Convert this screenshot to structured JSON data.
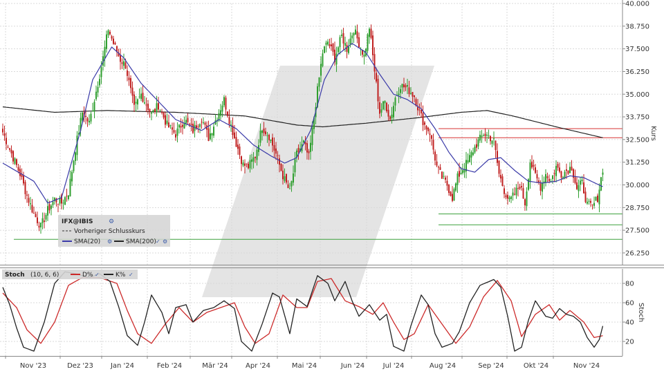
{
  "chart_data": [
    {
      "type": "candlestick",
      "instrument": "IFX@IBIS",
      "ylabel": "Kurs",
      "ylim": [
        25.6,
        40.0
      ],
      "yticks": [
        40.0,
        38.75,
        37.5,
        36.25,
        35.0,
        33.75,
        32.5,
        31.25,
        30.0,
        28.75,
        27.5,
        26.25
      ],
      "ytick_labels": [
        "40.000",
        "38.750",
        "37.500",
        "36.250",
        "35.000",
        "33.750",
        "32.500",
        "31.250",
        "30.000",
        "28.750",
        "27.500",
        "26.250"
      ],
      "x_tick_labels": [
        "Nov '23",
        "Dez '23",
        "Jan '24",
        "Feb '24",
        "Mär '24",
        "Apr '24",
        "Mai '24",
        "Jun '24",
        "Jul '24",
        "Aug '24",
        "Sep '24",
        "Okt '24",
        "Nov '24"
      ],
      "grid": true,
      "legend": {
        "title": "IFX@IBIS",
        "entries": [
          {
            "label": "Vorheriger Schlusskurs",
            "style": "dashed",
            "color": "#333333"
          },
          {
            "label": "SMA(20)",
            "color": "#3a3aa8"
          },
          {
            "label": "SMA(200)",
            "color": "#222222"
          }
        ]
      },
      "close_series_anchors": [
        [
          0,
          32.9
        ],
        [
          6,
          31.5
        ],
        [
          10,
          30.6
        ],
        [
          14,
          29.4
        ],
        [
          18,
          28.4
        ],
        [
          22,
          27.7
        ],
        [
          26,
          28.6
        ],
        [
          30,
          29.2
        ],
        [
          34,
          29.0
        ],
        [
          38,
          29.6
        ],
        [
          42,
          32.0
        ],
        [
          46,
          34.0
        ],
        [
          50,
          33.4
        ],
        [
          55,
          35.6
        ],
        [
          58,
          37.0
        ],
        [
          61,
          38.6
        ],
        [
          64,
          37.8
        ],
        [
          68,
          36.9
        ],
        [
          71,
          36.6
        ],
        [
          76,
          34.2
        ],
        [
          80,
          35.0
        ],
        [
          86,
          33.9
        ],
        [
          90,
          34.4
        ],
        [
          95,
          33.3
        ],
        [
          100,
          32.8
        ],
        [
          105,
          33.6
        ],
        [
          110,
          33.0
        ],
        [
          115,
          33.7
        ],
        [
          119,
          32.6
        ],
        [
          124,
          33.8
        ],
        [
          128,
          34.7
        ],
        [
          131,
          33.6
        ],
        [
          135,
          32.3
        ],
        [
          139,
          31.1
        ],
        [
          142,
          31.0
        ],
        [
          146,
          31.6
        ],
        [
          150,
          33.2
        ],
        [
          154,
          32.7
        ],
        [
          158,
          31.7
        ],
        [
          162,
          30.5
        ],
        [
          166,
          29.6
        ],
        [
          170,
          31.7
        ],
        [
          174,
          32.3
        ],
        [
          177,
          31.5
        ],
        [
          181,
          34.5
        ],
        [
          185,
          37.3
        ],
        [
          188,
          37.9
        ],
        [
          192,
          37.0
        ],
        [
          196,
          38.2
        ],
        [
          199,
          37.5
        ],
        [
          203,
          38.6
        ],
        [
          206,
          37.8
        ],
        [
          209,
          37.1
        ],
        [
          212,
          38.7
        ],
        [
          215,
          36.3
        ],
        [
          218,
          34.0
        ],
        [
          221,
          34.6
        ],
        [
          224,
          33.6
        ],
        [
          227,
          34.8
        ],
        [
          230,
          35.5
        ],
        [
          234,
          35.3
        ],
        [
          238,
          34.9
        ],
        [
          241,
          34.0
        ],
        [
          244,
          33.3
        ],
        [
          247,
          32.9
        ],
        [
          251,
          31.0
        ],
        [
          254,
          30.4
        ],
        [
          257,
          30.0
        ],
        [
          260,
          29.3
        ],
        [
          263,
          30.4
        ],
        [
          266,
          30.9
        ],
        [
          269,
          31.3
        ],
        [
          272,
          31.9
        ],
        [
          275,
          32.4
        ],
        [
          278,
          32.8
        ],
        [
          281,
          32.7
        ],
        [
          284,
          32.4
        ],
        [
          287,
          30.6
        ],
        [
          290,
          29.7
        ],
        [
          293,
          29.1
        ],
        [
          296,
          29.5
        ],
        [
          299,
          30.0
        ],
        [
          302,
          29.0
        ],
        [
          305,
          31.3
        ],
        [
          308,
          30.5
        ],
        [
          311,
          29.9
        ],
        [
          314,
          30.6
        ],
        [
          317,
          30.2
        ],
        [
          320,
          31.0
        ],
        [
          323,
          30.6
        ],
        [
          326,
          30.8
        ],
        [
          329,
          31.0
        ],
        [
          332,
          29.8
        ],
        [
          335,
          30.1
        ],
        [
          338,
          28.9
        ],
        [
          341,
          28.8
        ],
        [
          344,
          29.3
        ],
        [
          347,
          30.9
        ]
      ],
      "sma20_anchors": [
        [
          0,
          31.2
        ],
        [
          18,
          30.2
        ],
        [
          26,
          29.0
        ],
        [
          34,
          29.3
        ],
        [
          45,
          33.0
        ],
        [
          52,
          35.8
        ],
        [
          63,
          37.6
        ],
        [
          70,
          37.0
        ],
        [
          80,
          35.6
        ],
        [
          90,
          34.6
        ],
        [
          100,
          33.6
        ],
        [
          115,
          33.0
        ],
        [
          125,
          33.6
        ],
        [
          135,
          33.1
        ],
        [
          145,
          32.2
        ],
        [
          155,
          31.6
        ],
        [
          163,
          31.2
        ],
        [
          170,
          31.5
        ],
        [
          178,
          33.0
        ],
        [
          186,
          35.8
        ],
        [
          194,
          37.2
        ],
        [
          202,
          37.8
        ],
        [
          210,
          37.3
        ],
        [
          218,
          36.1
        ],
        [
          226,
          35.0
        ],
        [
          234,
          34.7
        ],
        [
          242,
          34.2
        ],
        [
          250,
          33.1
        ],
        [
          258,
          31.8
        ],
        [
          265,
          30.9
        ],
        [
          273,
          30.7
        ],
        [
          281,
          31.4
        ],
        [
          288,
          31.5
        ],
        [
          296,
          30.8
        ],
        [
          304,
          30.2
        ],
        [
          312,
          30.1
        ],
        [
          320,
          30.2
        ],
        [
          328,
          30.5
        ],
        [
          336,
          30.4
        ],
        [
          347,
          29.9
        ]
      ],
      "sma200_anchors": [
        [
          0,
          34.3
        ],
        [
          30,
          34.0
        ],
        [
          60,
          34.1
        ],
        [
          100,
          34.0
        ],
        [
          140,
          33.8
        ],
        [
          170,
          33.3
        ],
        [
          185,
          33.2
        ],
        [
          210,
          33.4
        ],
        [
          240,
          33.7
        ],
        [
          265,
          34.0
        ],
        [
          280,
          34.1
        ],
        [
          295,
          33.8
        ],
        [
          320,
          33.2
        ],
        [
          347,
          32.6
        ]
      ],
      "horizontal_lines": [
        {
          "value": 33.1,
          "color": "#d83232"
        },
        {
          "value": 32.6,
          "color": "#d83232"
        },
        {
          "value": 28.4,
          "color": "#3ca03c"
        },
        {
          "value": 27.8,
          "color": "#3ca03c"
        },
        {
          "value": 27.0,
          "color": "#3ca03c"
        }
      ],
      "colors": {
        "up": "#2e9e2e",
        "down": "#c02020",
        "sma20": "#3a3aa8",
        "sma200": "#222222"
      }
    },
    {
      "type": "line",
      "title": "Stoch",
      "params": "(10, 6, 6)",
      "ylabel": "Stoch",
      "ylim": [
        5,
        95
      ],
      "yticks": [
        80,
        60,
        40,
        20
      ],
      "ytick_labels": [
        "80",
        "60",
        "40",
        "20"
      ],
      "grid": true,
      "series": [
        {
          "name": "D%",
          "color": "#cc2a2a",
          "anchors": [
            [
              0,
              70
            ],
            [
              8,
              55
            ],
            [
              14,
              32
            ],
            [
              22,
              18
            ],
            [
              30,
              40
            ],
            [
              38,
              78
            ],
            [
              46,
              86
            ],
            [
              56,
              86
            ],
            [
              66,
              80
            ],
            [
              72,
              52
            ],
            [
              78,
              28
            ],
            [
              86,
              18
            ],
            [
              94,
              38
            ],
            [
              102,
              55
            ],
            [
              110,
              40
            ],
            [
              118,
              50
            ],
            [
              126,
              55
            ],
            [
              134,
              60
            ],
            [
              140,
              35
            ],
            [
              146,
              18
            ],
            [
              154,
              28
            ],
            [
              162,
              68
            ],
            [
              170,
              55
            ],
            [
              176,
              55
            ],
            [
              182,
              82
            ],
            [
              190,
              85
            ],
            [
              198,
              62
            ],
            [
              206,
              56
            ],
            [
              214,
              48
            ],
            [
              220,
              60
            ],
            [
              226,
              40
            ],
            [
              232,
              22
            ],
            [
              238,
              28
            ],
            [
              246,
              58
            ],
            [
              254,
              38
            ],
            [
              262,
              18
            ],
            [
              270,
              35
            ],
            [
              278,
              66
            ],
            [
              286,
              83
            ],
            [
              294,
              62
            ],
            [
              300,
              25
            ],
            [
              308,
              48
            ],
            [
              316,
              58
            ],
            [
              322,
              42
            ],
            [
              328,
              52
            ],
            [
              336,
              40
            ],
            [
              342,
              24
            ],
            [
              347,
              26
            ]
          ]
        },
        {
          "name": "K%",
          "color": "#222222",
          "anchors": [
            [
              0,
              76
            ],
            [
              4,
              58
            ],
            [
              8,
              34
            ],
            [
              12,
              14
            ],
            [
              18,
              10
            ],
            [
              24,
              40
            ],
            [
              30,
              80
            ],
            [
              36,
              92
            ],
            [
              42,
              90
            ],
            [
              50,
              86
            ],
            [
              56,
              90
            ],
            [
              62,
              82
            ],
            [
              67,
              56
            ],
            [
              72,
              26
            ],
            [
              78,
              16
            ],
            [
              82,
              40
            ],
            [
              86,
              68
            ],
            [
              92,
              50
            ],
            [
              96,
              28
            ],
            [
              100,
              55
            ],
            [
              106,
              58
            ],
            [
              110,
              40
            ],
            [
              116,
              52
            ],
            [
              122,
              55
            ],
            [
              128,
              62
            ],
            [
              134,
              54
            ],
            [
              138,
              20
            ],
            [
              144,
              10
            ],
            [
              150,
              38
            ],
            [
              156,
              70
            ],
            [
              160,
              66
            ],
            [
              166,
              28
            ],
            [
              170,
              64
            ],
            [
              176,
              56
            ],
            [
              182,
              88
            ],
            [
              188,
              80
            ],
            [
              192,
              62
            ],
            [
              198,
              82
            ],
            [
              202,
              62
            ],
            [
              206,
              46
            ],
            [
              212,
              58
            ],
            [
              218,
              42
            ],
            [
              222,
              48
            ],
            [
              226,
              15
            ],
            [
              232,
              10
            ],
            [
              236,
              36
            ],
            [
              242,
              68
            ],
            [
              246,
              58
            ],
            [
              250,
              28
            ],
            [
              254,
              14
            ],
            [
              260,
              18
            ],
            [
              264,
              30
            ],
            [
              270,
              60
            ],
            [
              276,
              78
            ],
            [
              284,
              84
            ],
            [
              288,
              76
            ],
            [
              292,
              46
            ],
            [
              296,
              10
            ],
            [
              300,
              14
            ],
            [
              304,
              42
            ],
            [
              308,
              62
            ],
            [
              314,
              46
            ],
            [
              318,
              44
            ],
            [
              322,
              54
            ],
            [
              326,
              48
            ],
            [
              330,
              46
            ],
            [
              334,
              40
            ],
            [
              338,
              24
            ],
            [
              342,
              14
            ],
            [
              345,
              22
            ],
            [
              347,
              36
            ]
          ]
        }
      ]
    }
  ]
}
